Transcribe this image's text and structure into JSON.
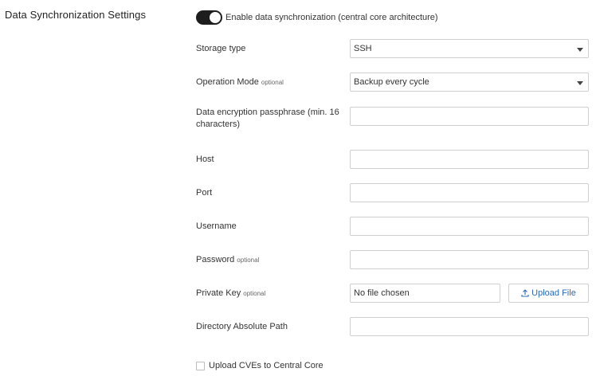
{
  "section": {
    "title": "Data Synchronization Settings"
  },
  "toggle": {
    "label": "Enable data synchronization (central core architecture)",
    "enabled": true
  },
  "fields": {
    "storage_type": {
      "label": "Storage type",
      "value": "SSH"
    },
    "operation_mode": {
      "label": "Operation Mode",
      "optional": "optional",
      "value": "Backup every cycle"
    },
    "passphrase": {
      "label_line1": "Data encryption passphrase (min. 16",
      "label_line2": "characters)",
      "value": ""
    },
    "host": {
      "label": "Host",
      "value": ""
    },
    "port": {
      "label": "Port",
      "value": ""
    },
    "username": {
      "label": "Username",
      "value": ""
    },
    "password": {
      "label": "Password",
      "optional": "optional",
      "value": ""
    },
    "private_key": {
      "label": "Private Key",
      "optional": "optional",
      "file_status": "No file chosen",
      "upload_label": "Upload File"
    },
    "directory": {
      "label": "Directory Absolute Path",
      "value": ""
    }
  },
  "checkbox": {
    "label": "Upload CVEs to Central Core",
    "checked": false
  },
  "icons": {
    "upload": "upload-icon",
    "caret": "chevron-down-icon"
  }
}
